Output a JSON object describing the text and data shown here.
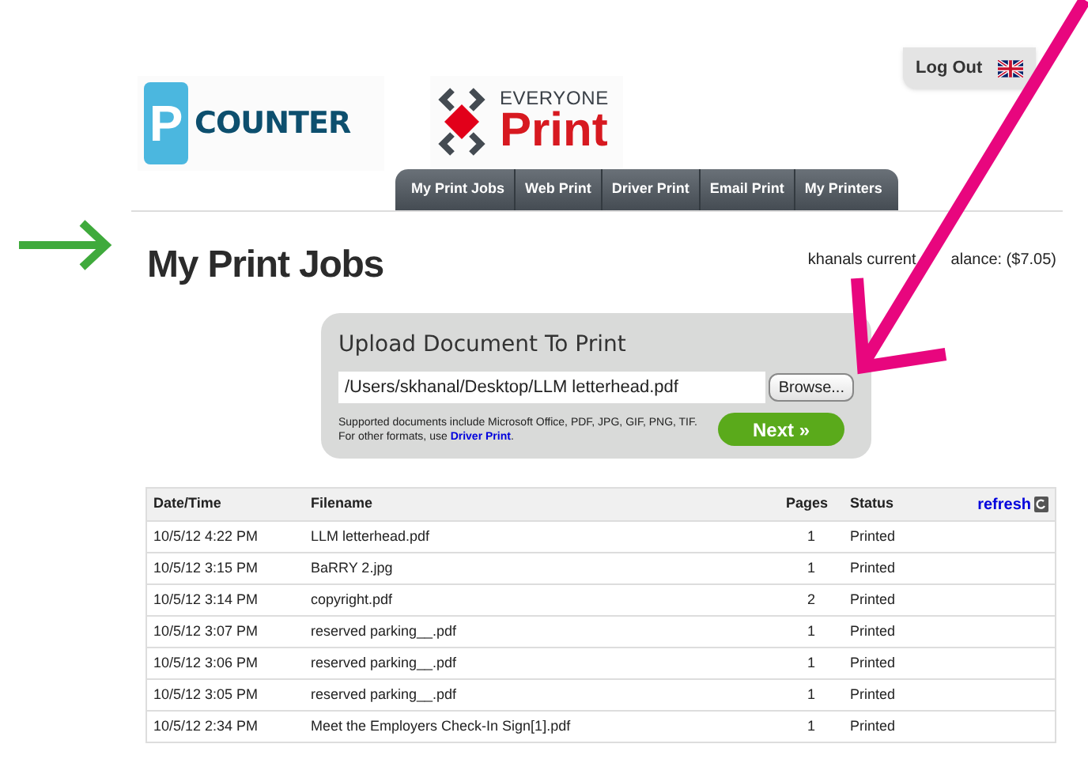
{
  "header": {
    "logout": "Log Out",
    "logos": [
      {
        "kind": "pcounter",
        "mark": "P",
        "text": "COUNTER"
      },
      {
        "kind": "everyone",
        "top": "EVERYONE",
        "bottom": "Print"
      }
    ]
  },
  "nav": [
    {
      "label": "My Print Jobs"
    },
    {
      "label": "Web Print"
    },
    {
      "label": "Driver Print"
    },
    {
      "label": "Email Print"
    },
    {
      "label": "My Printers"
    }
  ],
  "page_title": "My Print Jobs",
  "balance": [
    "khanals current",
    "alance: ($7.05)"
  ],
  "upload": {
    "title": "Upload Document To Print",
    "path": "/Users/skhanal/Desktop/LLM letterhead.pdf",
    "browse": "Browse...",
    "note": "Supported documents include Microsoft Office, PDF, JPG, GIF, PNG, TIF. For other formats, use ",
    "note_link": "Driver Print",
    "note_end": ".",
    "next": "Next »"
  },
  "table": {
    "columns": [
      "Date/Time",
      "Filename",
      "Pages",
      "Status"
    ],
    "refresh": "refresh",
    "rows": [
      {
        "date": "10/5/12 4:22 PM",
        "file": "LLM letterhead.pdf",
        "pages": "1",
        "status": "Printed"
      },
      {
        "date": "10/5/12 3:15 PM",
        "file": "BaRRY 2.jpg",
        "pages": "1",
        "status": "Printed"
      },
      {
        "date": "10/5/12 3:14 PM",
        "file": "copyright.pdf",
        "pages": "2",
        "status": "Printed"
      },
      {
        "date": "10/5/12 3:07 PM",
        "file": "reserved parking__.pdf",
        "pages": "1",
        "status": "Printed"
      },
      {
        "date": "10/5/12 3:06 PM",
        "file": "reserved parking__.pdf",
        "pages": "1",
        "status": "Printed"
      },
      {
        "date": "10/5/12 3:05 PM",
        "file": "reserved parking__.pdf",
        "pages": "1",
        "status": "Printed"
      },
      {
        "date": "10/5/12 2:34 PM",
        "file": "Meet the Employers Check-In Sign[1].pdf",
        "pages": "1",
        "status": "Printed"
      }
    ]
  }
}
